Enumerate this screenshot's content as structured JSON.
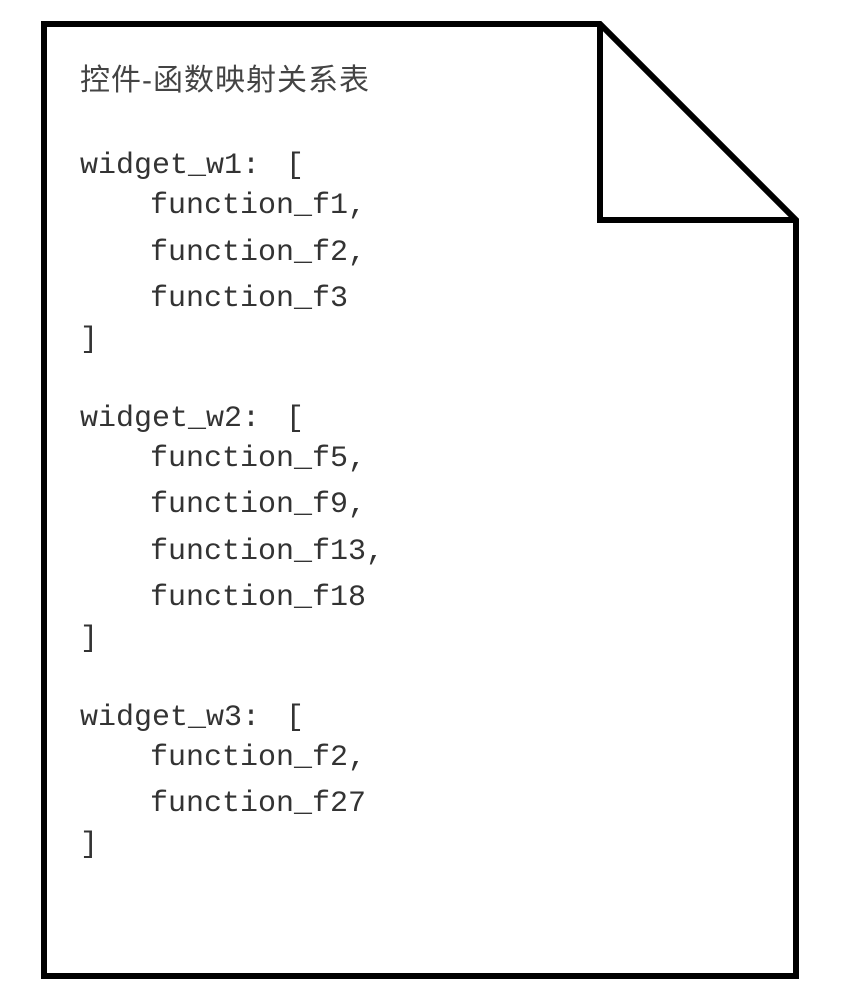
{
  "title": "控件-函数映射关系表",
  "mappings": [
    {
      "key": "widget_w1",
      "functions": [
        "function_f1",
        "function_f2",
        "function_f3"
      ]
    },
    {
      "key": "widget_w2",
      "functions": [
        "function_f5",
        "function_f9",
        "function_f13",
        "function_f18"
      ]
    },
    {
      "key": "widget_w3",
      "functions": [
        "function_f2",
        "function_f27"
      ]
    }
  ]
}
